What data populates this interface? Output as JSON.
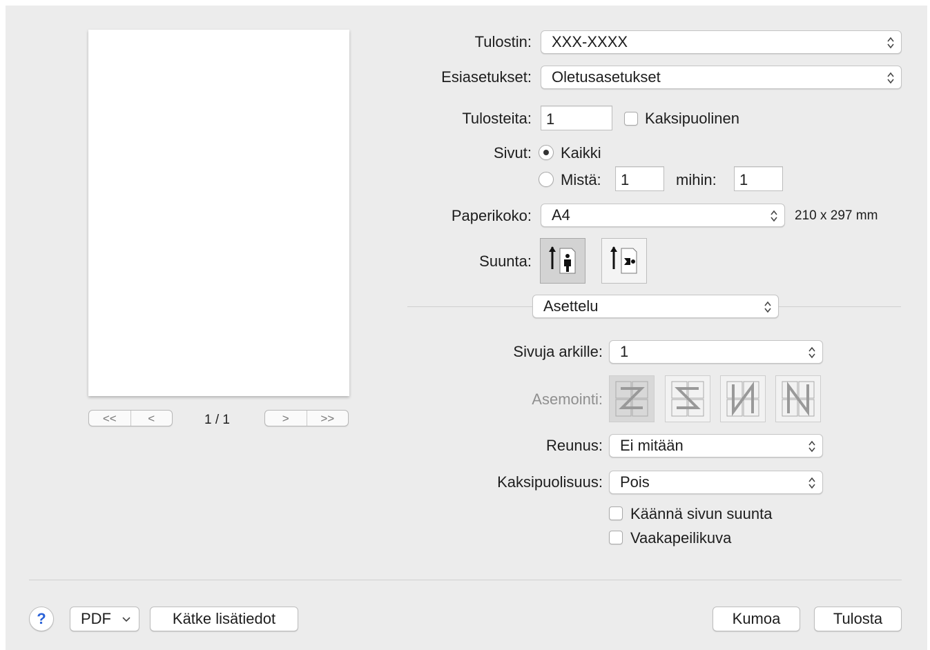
{
  "preview": {
    "nav_first": "<<",
    "nav_prev": "<",
    "page_counter": "1 / 1",
    "nav_next": ">",
    "nav_last": ">>"
  },
  "printer": {
    "label": "Tulostin:",
    "value": "XXX-XXXX"
  },
  "presets": {
    "label": "Esiasetukset:",
    "value": "Oletusasetukset"
  },
  "copies": {
    "label": "Tulosteita:",
    "value": "1",
    "duplex_label": "Kaksipuolinen",
    "duplex_checked": false
  },
  "pages": {
    "label": "Sivut:",
    "all_label": "Kaikki",
    "all_selected": true,
    "from_label": "Mistä:",
    "from_value": "1",
    "to_label": "mihin:",
    "to_value": "1"
  },
  "paper_size": {
    "label": "Paperikoko:",
    "value": "A4",
    "dimensions": "210 x 297 mm"
  },
  "orientation": {
    "label": "Suunta:",
    "selected": "portrait",
    "icons": [
      "portrait-icon",
      "landscape-icon"
    ]
  },
  "section_popup": {
    "value": "Asettelu"
  },
  "layout": {
    "pages_per_sheet_label": "Sivuja arkille:",
    "pages_per_sheet_value": "1",
    "direction_label": "Asemointi:",
    "direction_icons": [
      "z-order-icon",
      "reverse-z-order-icon",
      "n-order-icon",
      "reverse-n-order-icon"
    ],
    "border_label": "Reunus:",
    "border_value": "Ei mitään",
    "two_sided_label": "Kaksipuolisuus:",
    "two_sided_value": "Pois",
    "reverse_orientation_label": "Käännä sivun suunta",
    "flip_horizontally_label": "Vaakapeilikuva"
  },
  "footer": {
    "help_label": "?",
    "pdf_label": "PDF",
    "hide_details_label": "Kätke lisätiedot",
    "cancel_label": "Kumoa",
    "print_label": "Tulosta"
  },
  "colors": {
    "help_blue": "#2a62d8",
    "dialog_bg": "#ececec"
  }
}
